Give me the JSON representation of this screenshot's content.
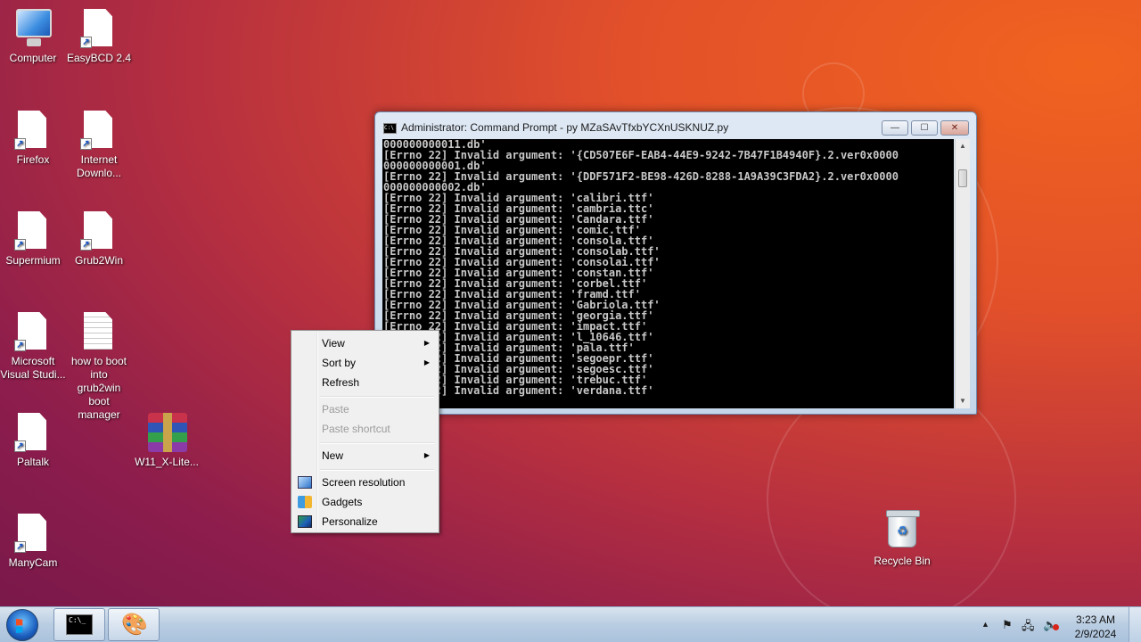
{
  "desktop": {
    "icons": [
      {
        "label": "Computer"
      },
      {
        "label": "EasyBCD 2.4"
      },
      {
        "label": "Firefox"
      },
      {
        "label": "Internet Downlo..."
      },
      {
        "label": "Supermium"
      },
      {
        "label": "Grub2Win"
      },
      {
        "label": "Microsoft Visual Studi..."
      },
      {
        "label": "how to boot into grub2win boot manager"
      },
      {
        "label": "Paltalk"
      },
      {
        "label": "W11_X-Lite..."
      },
      {
        "label": "ManyCam"
      },
      {
        "label": "Recycle Bin"
      }
    ]
  },
  "cmd_window": {
    "icon_text": "C:\\",
    "title": "Administrator:  Command Prompt - py  MZaSAvTfxbYCXnUSKNUZ.py",
    "buttons": {
      "minimize": "—",
      "maximize": "☐",
      "close": "✕"
    },
    "lines": [
      "000000000011.db'",
      "[Errno 22] Invalid argument: '{CD507E6F-EAB4-44E9-9242-7B47F1B4940F}.2.ver0x0000",
      "000000000001.db'",
      "[Errno 22] Invalid argument: '{DDF571F2-BE98-426D-8288-1A9A39C3FDA2}.2.ver0x0000",
      "000000000002.db'",
      "[Errno 22] Invalid argument: 'calibri.ttf'",
      "[Errno 22] Invalid argument: 'cambria.ttc'",
      "[Errno 22] Invalid argument: 'Candara.ttf'",
      "[Errno 22] Invalid argument: 'comic.ttf'",
      "[Errno 22] Invalid argument: 'consola.ttf'",
      "[Errno 22] Invalid argument: 'consolab.ttf'",
      "[Errno 22] Invalid argument: 'consolai.ttf'",
      "[Errno 22] Invalid argument: 'constan.ttf'",
      "[Errno 22] Invalid argument: 'corbel.ttf'",
      "[Errno 22] Invalid argument: 'framd.ttf'",
      "[Errno 22] Invalid argument: 'Gabriola.ttf'",
      "[Errno 22] Invalid argument: 'georgia.ttf'",
      "[Errno 22] Invalid argument: 'impact.ttf'",
      "[Errno 22] Invalid argument: 'l_10646.ttf'",
      "[Errno 22] Invalid argument: 'pala.ttf'",
      "[Errno 22] Invalid argument: 'segoepr.ttf'",
      "[Errno 22] Invalid argument: 'segoesc.ttf'",
      "[Errno 22] Invalid argument: 'trebuc.ttf'",
      "[Errno 22] Invalid argument: 'verdana.ttf'"
    ]
  },
  "context_menu": {
    "items": [
      {
        "label": "View",
        "has_submenu": true,
        "enabled": true
      },
      {
        "label": "Sort by",
        "has_submenu": true,
        "enabled": true
      },
      {
        "label": "Refresh",
        "enabled": true
      },
      {
        "label": "Paste",
        "enabled": false
      },
      {
        "label": "Paste shortcut",
        "enabled": false
      },
      {
        "label": "New",
        "has_submenu": true,
        "enabled": true
      },
      {
        "label": "Screen resolution",
        "icon": "screen-resolution-icon",
        "enabled": true
      },
      {
        "label": "Gadgets",
        "icon": "gadgets-icon",
        "enabled": true
      },
      {
        "label": "Personalize",
        "icon": "personalize-icon",
        "enabled": true
      }
    ],
    "submenu_arrow": "▶"
  },
  "taskbar": {
    "start_icon": "windows-logo-icon",
    "pinned": [
      {
        "name": "cmd-taskbar-button",
        "icon": "command-prompt-icon",
        "icon_text": "C:\\_"
      },
      {
        "name": "paint-taskbar-button",
        "icon": "paint-icon",
        "icon_text": "🎨"
      }
    ],
    "tray": {
      "show_hidden_arrow": "▲",
      "flag_glyph": "⚑",
      "network_glyph": "🖧",
      "volume_glyph": "🔈"
    },
    "clock": {
      "time": "3:23 AM",
      "date": "2/9/2024"
    }
  },
  "colors": {
    "wallpaper_orange": "#f0631f",
    "wallpaper_purple": "#76184a",
    "console_bg": "#000000",
    "console_text": "#c8c8c8"
  }
}
